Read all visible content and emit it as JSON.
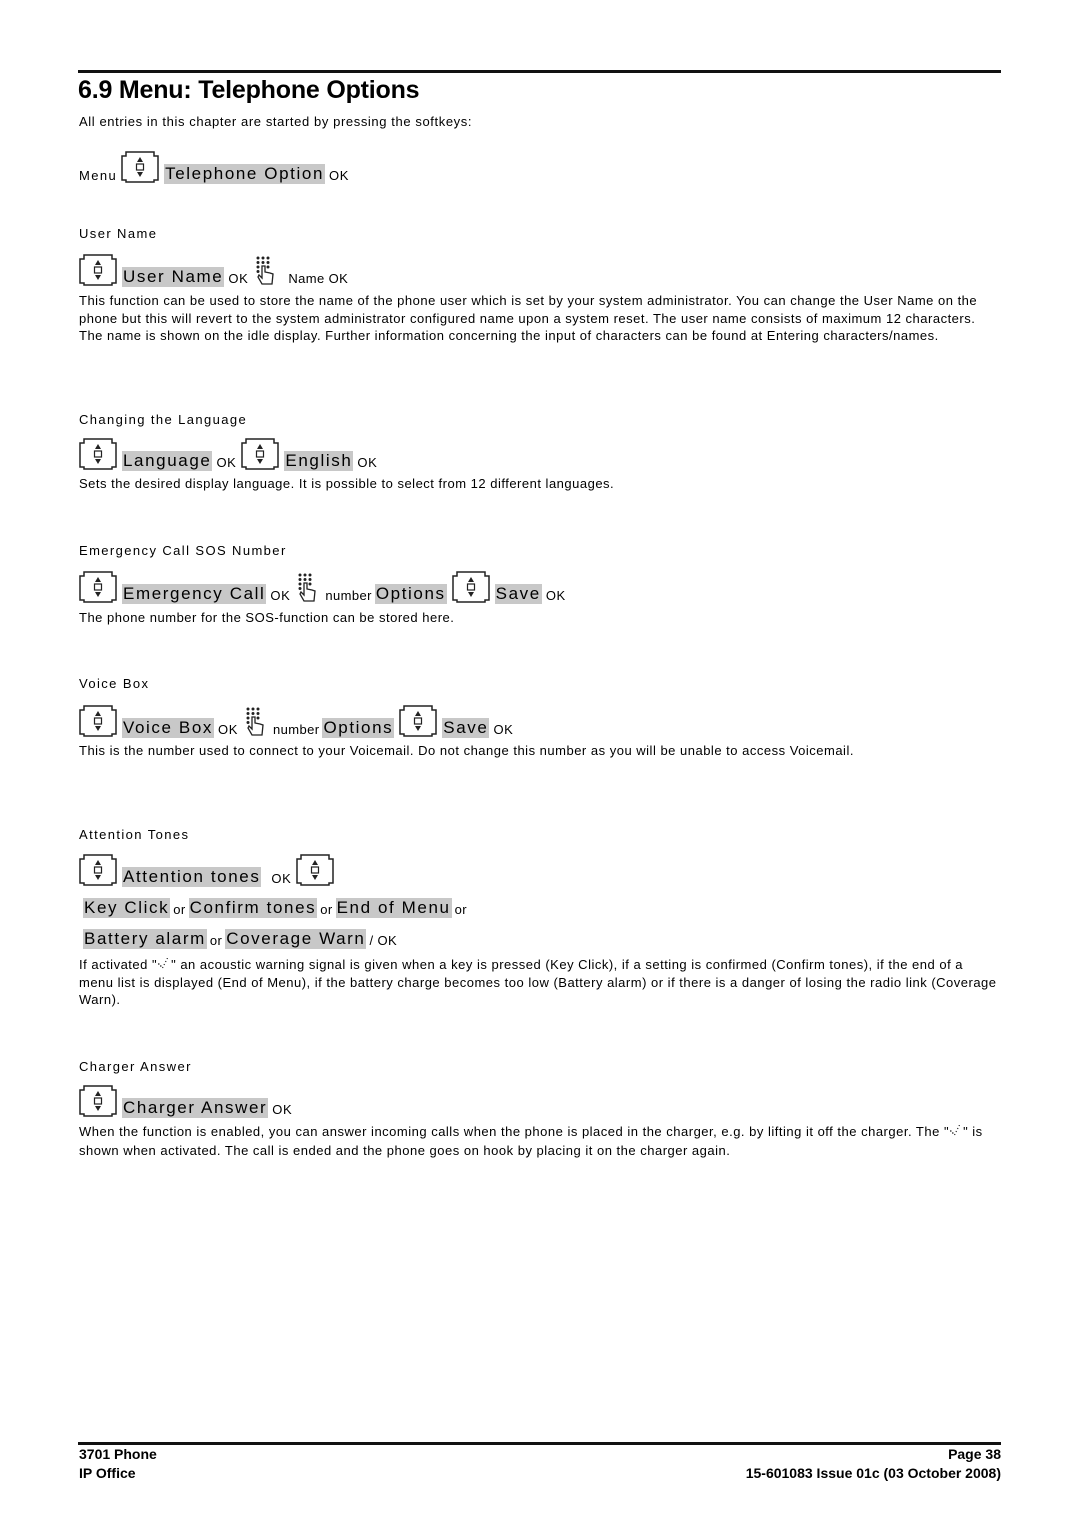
{
  "header": {
    "title": "6.9 Menu: Telephone Options",
    "intro": "All entries in this chapter are started by pressing the softkeys:"
  },
  "menu_path": {
    "menu": "Menu",
    "option": "Telephone Option",
    "ok": "OK"
  },
  "sections": {
    "user_name": {
      "heading": "User Name",
      "item": "User Name",
      "ok1": "OK",
      "tail": "Name OK",
      "description": "This function can be used to store the name of the phone user which is set by your system administrator. You can change the User Name on the phone but this will revert to the system administrator configured name upon a system reset. The user name consists of maximum 12 characters. The name is shown on the idle display. Further information concerning the input of characters can be found at Entering characters/names."
    },
    "language": {
      "heading": "Changing the Language",
      "item": "Language",
      "ok1": "OK",
      "value": "English",
      "ok2": "OK",
      "description": "Sets the desired display language. It is possible to select from 12 different languages."
    },
    "emergency": {
      "heading": "Emergency Call SOS Number",
      "item": "Emergency Call",
      "ok1": "OK",
      "number": "number",
      "options": "Options",
      "save": "Save",
      "ok2": "OK",
      "description": "The phone number for the SOS-function can be stored here."
    },
    "voice_box": {
      "heading": "Voice Box",
      "item": "Voice Box",
      "ok1": "OK",
      "number": "number",
      "options": "Options",
      "save": "Save",
      "ok2": "OK",
      "description": "This is the number used to connect to your Voicemail. Do not change this number as you will be unable to access Voicemail."
    },
    "attention_tones": {
      "heading": "Attention Tones",
      "item": "Attention tones",
      "ok1": "OK",
      "opt1": "Key Click",
      "opt2": "Confirm tones",
      "opt3": "End of Menu",
      "opt4": "Battery alarm",
      "opt5": "Coverage Warn",
      "or": "or",
      "tail": "/ OK",
      "desc_pre": "If activated \"",
      "desc_post": "\" an acoustic warning signal is given when a key is pressed (Key Click), if a setting is confirmed (Confirm tones), if the end of a menu list is displayed (End of Menu), if the battery charge becomes too low (Battery alarm) or if there is a danger of losing the radio link (Coverage Warn)."
    },
    "charger_answer": {
      "heading": "Charger Answer",
      "item": "Charger Answer",
      "ok1": "OK",
      "desc_pre": "When the function is enabled, you can answer incoming calls when the phone is placed in the charger, e.g. by lifting it off the charger. The \"",
      "desc_post": "\" is shown when activated. The call is ended and the phone goes on hook by placing it on the charger again."
    }
  },
  "icons": {
    "nav_key": "navigation-key-icon",
    "keypad": "keypad-hand-icon",
    "check": "checkmark-icon"
  },
  "footer": {
    "product": "3701 Phone",
    "system": "IP Office",
    "page": "Page 38",
    "issue": "15-601083 Issue 01c (03 October 2008)"
  }
}
